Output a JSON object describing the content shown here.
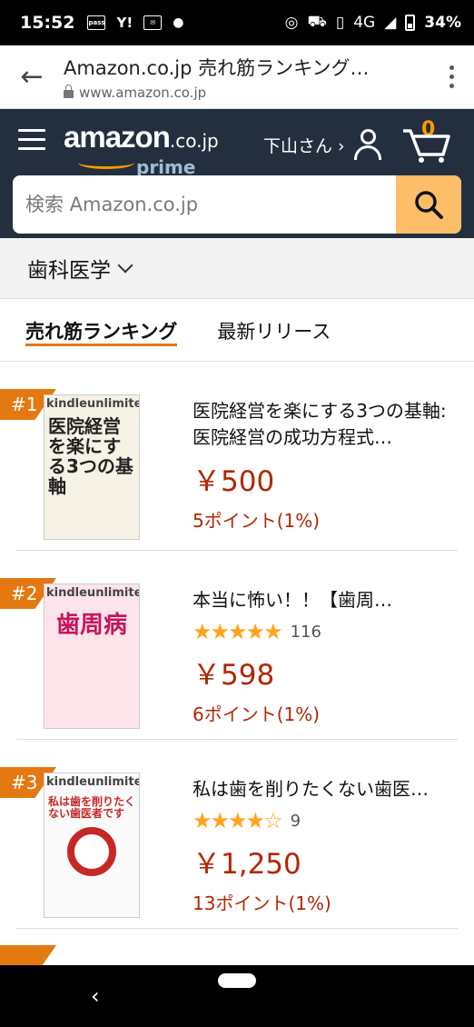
{
  "status": {
    "time": "15:52",
    "icons_left": [
      "pass",
      "Y!",
      "mail-icon",
      "dot"
    ],
    "network": "4G",
    "battery": "34%"
  },
  "browser": {
    "title": "Amazon.co.jp 売れ筋ランキング…",
    "url": "www.amazon.co.jp"
  },
  "header": {
    "logo_word": "amazon",
    "logo_suffix": ".co.jp",
    "logo_sub": "prime",
    "user_label": "下山さん ›",
    "cart_count": "0",
    "search_placeholder": "検索 Amazon.co.jp"
  },
  "category": {
    "label": "歯科医学"
  },
  "tabs": [
    {
      "label": "売れ筋ランキング",
      "active": true
    },
    {
      "label": "最新リリース",
      "active": false
    }
  ],
  "products": [
    {
      "rank": "#1",
      "cover_badge": "kindleunlimited",
      "cover_title": "医院経営を楽にする3つの基軸",
      "title": "医院経営を楽にする3つの基軸: 医院経営の成功方程式…",
      "rating": 0,
      "reviews": "",
      "price": "￥500",
      "points": "5ポイント(1%)"
    },
    {
      "rank": "#2",
      "cover_badge": "kindleunlimited",
      "cover_title": "歯周病",
      "title": "本当に怖い！！【歯周…",
      "rating": 5,
      "reviews": "116",
      "price": "￥598",
      "points": "6ポイント(1%)"
    },
    {
      "rank": "#3",
      "cover_badge": "kindleunlimited",
      "cover_title": "私は歯を削りたくない歯医者です",
      "title": "私は歯を削りたくない歯医…",
      "rating": 4.5,
      "reviews": "9",
      "price": "￥1,250",
      "points": "13ポイント(1%)"
    }
  ],
  "colors": {
    "header_bg": "#232f3e",
    "accent": "#e47911",
    "price": "#b12704",
    "search_btn": "#febd69"
  }
}
